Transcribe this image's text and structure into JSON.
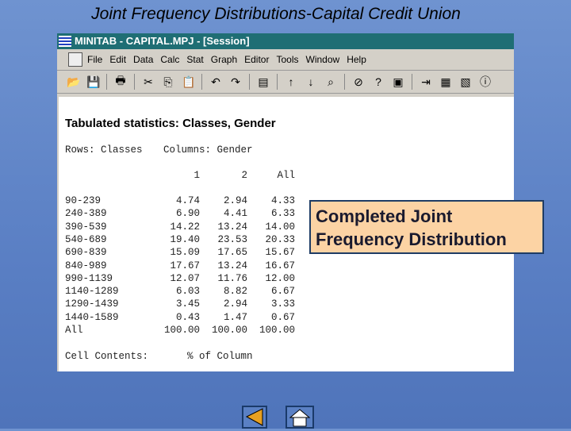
{
  "slide_title": "Joint Frequency Distributions-Capital Credit Union",
  "window_title": "MINITAB - CAPITAL.MPJ - [Session]",
  "menu": [
    "File",
    "Edit",
    "Data",
    "Calc",
    "Stat",
    "Graph",
    "Editor",
    "Tools",
    "Window",
    "Help"
  ],
  "toolbar": [
    "open-icon",
    "save-icon",
    "print-icon",
    "cut-icon",
    "copy-icon",
    "paste-icon",
    "undo-icon",
    "redo-icon",
    "worksheet-icon",
    "up-arrow-icon",
    "down-arrow-icon",
    "find-icon",
    "cancel-icon",
    "help-icon",
    "project-manager-icon",
    "session-icon",
    "data-icon",
    "graph-icon",
    "info-icon"
  ],
  "session": {
    "heading": "Tabulated statistics: Classes, Gender",
    "rows_label": "Rows: Classes",
    "cols_label": "Columns: Gender",
    "columns": [
      "1",
      "2",
      "All"
    ],
    "rows": [
      [
        "90-239",
        "4.74",
        "2.94",
        "4.33"
      ],
      [
        "240-389",
        "6.90",
        "4.41",
        "6.33"
      ],
      [
        "390-539",
        "14.22",
        "13.24",
        "14.00"
      ],
      [
        "540-689",
        "19.40",
        "23.53",
        "20.33"
      ],
      [
        "690-839",
        "15.09",
        "17.65",
        "15.67"
      ],
      [
        "840-989",
        "17.67",
        "13.24",
        "16.67"
      ],
      [
        "990-1139",
        "12.07",
        "11.76",
        "12.00"
      ],
      [
        "1140-1289",
        "6.03",
        "8.82",
        "6.67"
      ],
      [
        "1290-1439",
        "3.45",
        "2.94",
        "3.33"
      ],
      [
        "1440-1589",
        "0.43",
        "1.47",
        "0.67"
      ],
      [
        "All",
        "100.00",
        "100.00",
        "100.00"
      ]
    ],
    "cell_contents_label": "Cell Contents:",
    "cell_contents_value": "% of Column"
  },
  "callout": {
    "line1": "Completed Joint",
    "line2": "Frequency Distribution"
  }
}
